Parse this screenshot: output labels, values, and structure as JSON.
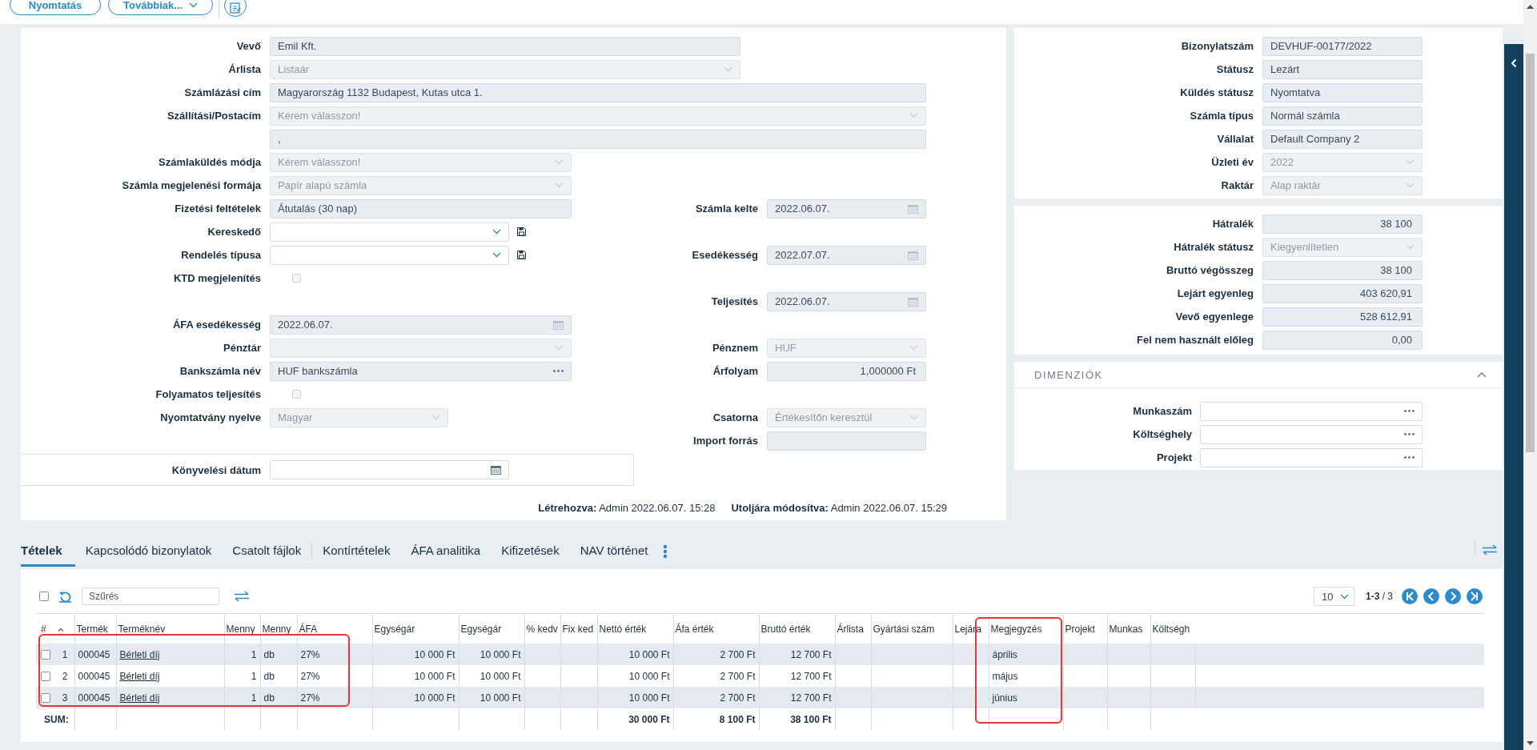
{
  "toolbar": {
    "buttons": [
      {
        "label": "Nyomtatás",
        "kind": "plain"
      },
      {
        "label": "Továbbiak...",
        "kind": "menu"
      }
    ]
  },
  "form": {
    "rows": [
      {
        "left": {
          "label": "Vevő",
          "kind": "text",
          "disabled": true,
          "value": "Emil Kft."
        }
      },
      {
        "left": {
          "label": "Árlista",
          "kind": "select",
          "disabled": true,
          "value": "Listaár"
        }
      },
      {
        "left": {
          "label": "Számlázási cím",
          "kind": "text",
          "disabled": true,
          "value": "Magyarország 1132 Budapest, Kutas utca 1."
        }
      },
      {
        "left": {
          "label": "Szállítási/Postacím",
          "kind": "select",
          "disabled": true,
          "placeholder": "Kérem válasszon!"
        }
      },
      {
        "left": {
          "kind": "text",
          "disabled": true,
          "value": ","
        }
      },
      {
        "left": {
          "label": "Számlaküldés módja",
          "kind": "select",
          "disabled": true,
          "placeholder": "Kérem válasszon!"
        }
      },
      {
        "left": {
          "label": "Számla megjelenési formája",
          "kind": "select",
          "disabled": true,
          "value": "Papír alapú számla"
        }
      },
      {
        "left": {
          "label": "Fizetési feltételek",
          "kind": "text",
          "disabled": true,
          "value": "Átutalás (30 nap)"
        },
        "right": {
          "label": "Számla kelte",
          "kind": "date",
          "disabled": true,
          "value": "2022.06.07."
        }
      },
      {
        "left": {
          "label": "Kereskedő",
          "kind": "select",
          "disabled": false
        }
      },
      {
        "left": {
          "label": "Rendelés típusa",
          "kind": "select",
          "disabled": false
        },
        "right": {
          "label": "Esedékesség",
          "kind": "date",
          "disabled": true,
          "value": "2022.07.07."
        }
      },
      {
        "left": {
          "label": "KTD megjelenítés",
          "kind": "checkbox",
          "disabled": true,
          "checked": false
        }
      },
      {
        "right": {
          "label": "Teljesítés",
          "kind": "date",
          "disabled": true,
          "value": "2022.06.07."
        }
      },
      {
        "left": {
          "label": "ÁFA esedékesség",
          "kind": "date",
          "disabled": true,
          "value": "2022.06.07."
        }
      },
      {
        "left": {
          "label": "Pénztár",
          "kind": "select",
          "disabled": true
        },
        "right": {
          "label": "Pénznem",
          "kind": "select",
          "disabled": true,
          "value": "HUF"
        }
      },
      {
        "left": {
          "label": "Bankszámla név",
          "kind": "lookup",
          "disabled": true,
          "value": "HUF bankszámla"
        },
        "right": {
          "label": "Árfolyam",
          "kind": "amount",
          "disabled": true,
          "value": "1,000000 Ft"
        }
      },
      {
        "left": {
          "label": "Folyamatos teljesítés",
          "kind": "checkbox",
          "disabled": true,
          "checked": false
        }
      },
      {
        "left": {
          "label": "Nyomtatvány nyelve",
          "kind": "select",
          "disabled": true,
          "value": "Magyar"
        },
        "right": {
          "label": "Csatorna",
          "kind": "select",
          "disabled": true,
          "value": "Értékesítőn keresztül"
        }
      },
      {
        "right": {
          "label": "Import forrás",
          "kind": "text",
          "disabled": true
        }
      }
    ],
    "posting_date": {
      "label": "Könyvelési dátum",
      "kind": "date",
      "disabled": false
    },
    "footer": [
      "**Létrehozva:** Admin 2022.06.07. 15:28",
      "**Utoljára módosítva:** Admin 2022.06.07. 15:29"
    ]
  },
  "document_panel": {
    "fields": [
      {
        "label": "Bizonylatszám",
        "kind": "text",
        "disabled": true,
        "value": "DEVHUF-00177/2022"
      },
      {
        "label": "Státusz",
        "kind": "text",
        "disabled": true,
        "value": "Lezárt"
      },
      {
        "label": "Küldés státusz",
        "kind": "text",
        "disabled": true,
        "value": "Nyomtatva"
      },
      {
        "label": "Számla típus",
        "kind": "text",
        "disabled": true,
        "value": "Normál számla"
      },
      {
        "label": "Vállalat",
        "kind": "text",
        "disabled": true,
        "value": "Default Company 2"
      },
      {
        "label": "Üzleti év",
        "kind": "select",
        "disabled": true,
        "value": "2022"
      },
      {
        "label": "Raktár",
        "kind": "select",
        "disabled": true,
        "value": "Alap raktár"
      }
    ]
  },
  "balance_panel": {
    "fields": [
      {
        "label": "Hátralék",
        "kind": "amount",
        "disabled": true,
        "value": "38 100"
      },
      {
        "label": "Hátralék státusz",
        "kind": "select",
        "disabled": true,
        "value": "Kiegyenlítetlen"
      },
      {
        "label": "Bruttó végösszeg",
        "kind": "amount",
        "disabled": true,
        "value": "38 100"
      },
      {
        "label": "Lejárt egyenleg",
        "kind": "amount",
        "disabled": true,
        "value": "403 620,91"
      },
      {
        "label": "Vevő egyenlege",
        "kind": "amount",
        "disabled": true,
        "value": "528 612,91"
      },
      {
        "label": "Fel nem használt előleg",
        "kind": "amount",
        "disabled": true,
        "value": "0,00"
      }
    ]
  },
  "dimensions": {
    "title": "DIMENZIÓK",
    "expanded": true,
    "fields": [
      {
        "label": "Munkaszám",
        "kind": "lookup",
        "disabled": false
      },
      {
        "label": "Költséghely",
        "kind": "lookup",
        "disabled": false
      },
      {
        "label": "Projekt",
        "kind": "lookup",
        "disabled": false
      }
    ]
  },
  "tabs": [
    {
      "label": "Tételek",
      "selected": true
    },
    {
      "label": "Kapcsolódó bizonylatok",
      "selected": false
    },
    {
      "label": "Csatolt fájlok",
      "selected": false
    },
    {
      "label": "Kontírtételek",
      "selected": false
    },
    {
      "label": "ÁFA analitika",
      "selected": false
    },
    {
      "label": "Kifizetések",
      "selected": false
    },
    {
      "label": "NAV történet",
      "selected": false
    }
  ],
  "table": {
    "select_all": {
      "checked": false
    },
    "filter": {
      "placeholder": "Szűrés"
    },
    "page_size": "10",
    "range": "**1-3** / 3",
    "columns": [
      {
        "label": "#",
        "kind": "index"
      },
      {
        "label": "Termék",
        "kind": "text"
      },
      {
        "label": "Terméknév",
        "kind": "link"
      },
      {
        "label": "Menny",
        "kind": "number"
      },
      {
        "label": "Menny",
        "kind": "text"
      },
      {
        "label": "ÁFA",
        "kind": "text"
      },
      {
        "label": "Egységár",
        "kind": "number"
      },
      {
        "label": "Egységár",
        "kind": "number"
      },
      {
        "label": "% kedv",
        "kind": "number"
      },
      {
        "label": "Fix ked",
        "kind": "number"
      },
      {
        "label": "Nettó érték",
        "kind": "number"
      },
      {
        "label": "Áfa érték",
        "kind": "number"
      },
      {
        "label": "Bruttó érték",
        "kind": "number"
      },
      {
        "label": "Árlista",
        "kind": "text"
      },
      {
        "label": "Gyártási szám",
        "kind": "text"
      },
      {
        "label": "Lejára",
        "kind": "text"
      },
      {
        "label": "Megjegyzés",
        "kind": "text"
      },
      {
        "label": "Projekt",
        "kind": "text"
      },
      {
        "label": "Munkas",
        "kind": "text"
      },
      {
        "label": "Költségh",
        "kind": "text"
      }
    ],
    "rows": [
      {
        "checked": false,
        "cells": [
          "1",
          "000045",
          "Bérleti díj",
          "1",
          "db",
          "27%",
          "10 000 Ft",
          "10 000 Ft",
          null,
          null,
          "10 000 Ft",
          "2 700 Ft",
          "12 700 Ft",
          null,
          null,
          null,
          "április",
          null,
          null,
          null
        ]
      },
      {
        "checked": false,
        "cells": [
          "2",
          "000045",
          "Bérleti díj",
          "1",
          "db",
          "27%",
          "10 000 Ft",
          "10 000 Ft",
          null,
          null,
          "10 000 Ft",
          "2 700 Ft",
          "12 700 Ft",
          null,
          null,
          null,
          "május",
          null,
          null,
          null
        ]
      },
      {
        "checked": false,
        "cells": [
          "3",
          "000045",
          "Bérleti díj",
          "1",
          "db",
          "27%",
          "10 000 Ft",
          "10 000 Ft",
          null,
          null,
          "10 000 Ft",
          "2 700 Ft",
          "12 700 Ft",
          null,
          null,
          null,
          "június",
          null,
          null,
          null
        ]
      }
    ],
    "sum": {
      "cells": [
        "SUM:",
        null,
        null,
        null,
        null,
        null,
        null,
        null,
        null,
        null,
        "30 000 Ft",
        "8 100 Ft",
        "38 100 Ft",
        null,
        null,
        null,
        null,
        null,
        null,
        null
      ]
    }
  }
}
